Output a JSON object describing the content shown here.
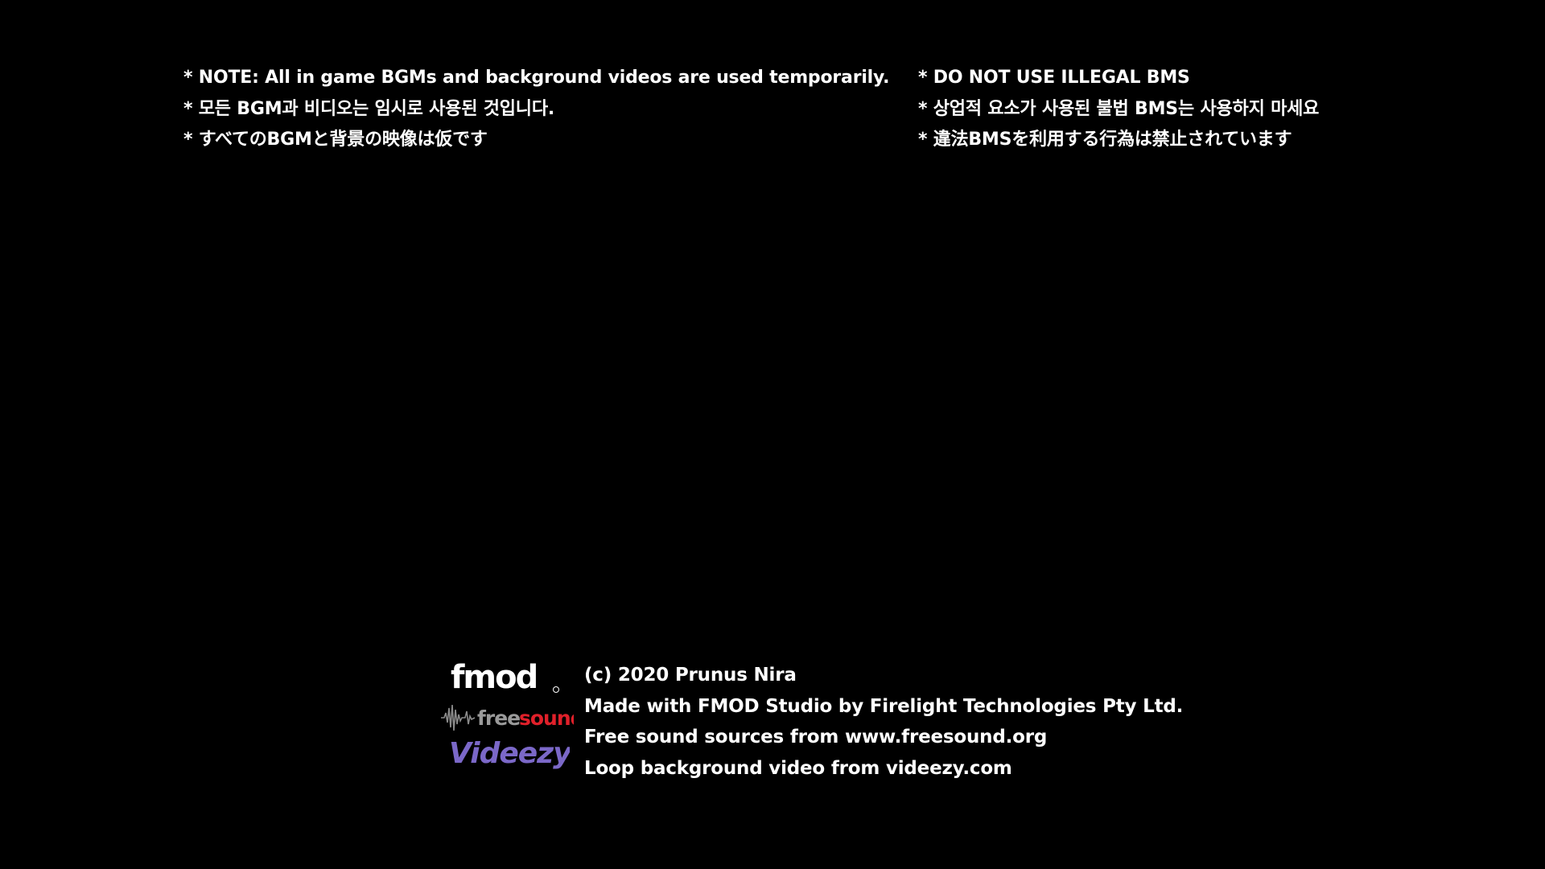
{
  "notices": {
    "left": [
      "* NOTE: All in game BGMs and background videos are used temporarily.",
      "* 모든 BGM과 비디오는 임시로 사용된 것입니다.",
      "* すべてのBGMと背景の映像は仮です"
    ],
    "right": [
      "* DO NOT USE ILLEGAL BMS",
      "* 상업적 요소가 사용된 불법 BMS는 사용하지 마세요",
      "* 違法BMSを利用する行為は禁止されています"
    ]
  },
  "logos": {
    "fmod": "fmod",
    "freesound_left": "free",
    "freesound_right": "sound",
    "videezy": "Videezy"
  },
  "credits": [
    "(c) 2020 Prunus Nira",
    "Made with FMOD Studio by Firelight Technologies Pty Ltd.",
    "Free sound sources from www.freesound.org",
    "Loop background video from videezy.com"
  ],
  "colors": {
    "background": "#000000",
    "text": "#ffffff",
    "freesound_grey": "#9a9a9a",
    "freesound_red": "#e0202a",
    "videezy_purple": "#7b68c8"
  }
}
